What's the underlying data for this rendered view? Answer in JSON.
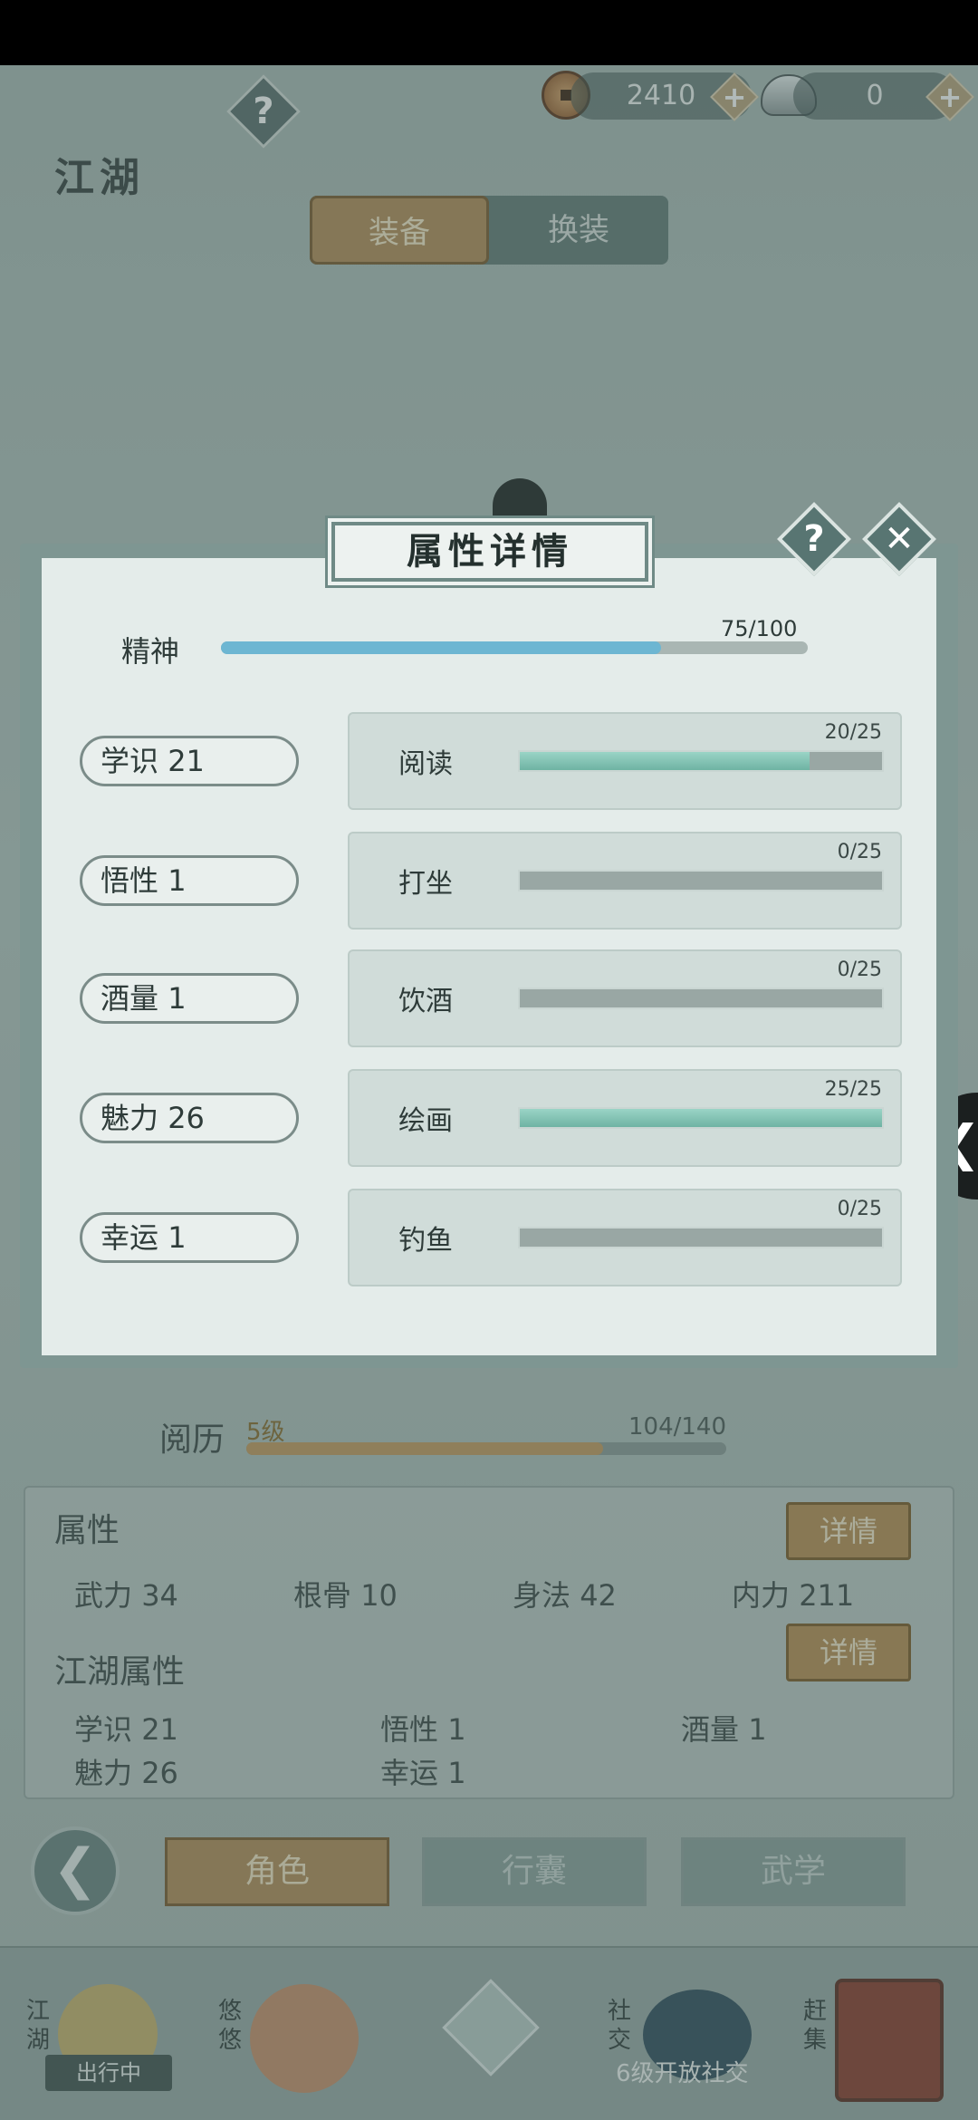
{
  "header": {
    "title": "江湖",
    "help_glyph": "?",
    "copper_coins": "2410",
    "silver_ingots": "0",
    "plus_glyph": "+"
  },
  "segment_tabs": [
    {
      "label": "装备",
      "active": true
    },
    {
      "label": "换装",
      "active": false
    }
  ],
  "modal": {
    "title": "属性详情",
    "help_glyph": "?",
    "close_glyph": "✕",
    "spirit": {
      "label": "精神",
      "value_text": "75/100",
      "fraction": 0.75
    },
    "rows": [
      {
        "stat_label": "学识",
        "stat_value": "21",
        "skill": "阅读",
        "skill_value_text": "20/25",
        "fraction": 0.8
      },
      {
        "stat_label": "悟性",
        "stat_value": "1",
        "skill": "打坐",
        "skill_value_text": "0/25",
        "fraction": 0
      },
      {
        "stat_label": "酒量",
        "stat_value": "1",
        "skill": "饮酒",
        "skill_value_text": "0/25",
        "fraction": 0
      },
      {
        "stat_label": "魅力",
        "stat_value": "26",
        "skill": "绘画",
        "skill_value_text": "25/25",
        "fraction": 1
      },
      {
        "stat_label": "幸运",
        "stat_value": "1",
        "skill": "钓鱼",
        "skill_value_text": "0/25",
        "fraction": 0
      }
    ]
  },
  "side_arrow_glyph": "❮",
  "experience": {
    "label": "阅历",
    "level": "5级",
    "value_text": "104/140",
    "fraction": 0.743
  },
  "attributes": {
    "heading": "属性",
    "detail_label": "详情",
    "items": [
      {
        "label": "武力",
        "value": "34"
      },
      {
        "label": "根骨",
        "value": "10"
      },
      {
        "label": "身法",
        "value": "42"
      },
      {
        "label": "内力",
        "value": "211"
      }
    ]
  },
  "jianghu_attributes": {
    "heading": "江湖属性",
    "detail_label": "详情",
    "items": [
      {
        "label": "学识",
        "value": "21"
      },
      {
        "label": "悟性",
        "value": "1"
      },
      {
        "label": "酒量",
        "value": "1"
      },
      {
        "label": "魅力",
        "value": "26"
      },
      {
        "label": "幸运",
        "value": "1"
      }
    ]
  },
  "back_glyph": "❮",
  "bottom_tabs": [
    {
      "label": "角色",
      "active": true
    },
    {
      "label": "行囊",
      "active": false
    },
    {
      "label": "武学",
      "active": false
    }
  ],
  "bottom_nav": {
    "jianghu": "江湖",
    "jianghu_badge": "出行中",
    "youyou": "悠悠",
    "social": "社交",
    "social_note": "6级开放社交",
    "market": "赶集"
  },
  "colors": {
    "accent_gold": "#b38c56",
    "teal_fill": "#6fb3a3",
    "spirit_blue": "#6db6d2",
    "modal_bg": "#e4ecea"
  }
}
